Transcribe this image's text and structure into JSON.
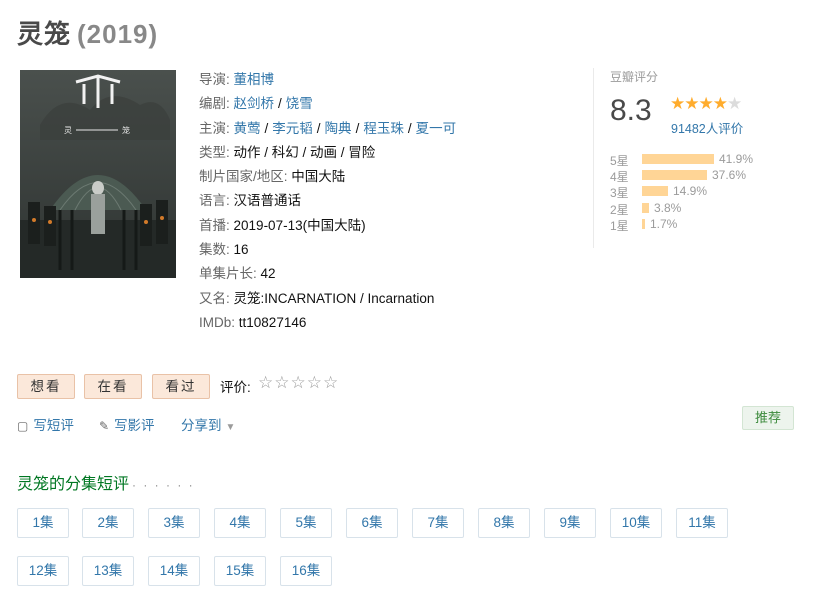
{
  "title": {
    "name": "灵笼",
    "year": "(2019)"
  },
  "poster": {
    "left_char": "灵",
    "right_char": "笼",
    "alt": "灵笼 poster"
  },
  "info": {
    "director": {
      "label": "导演:",
      "names": [
        "董相博"
      ]
    },
    "writer": {
      "label": "编剧:",
      "names": [
        "赵剑桥",
        "饶雪"
      ]
    },
    "cast": {
      "label": "主演:",
      "names": [
        "黄莺",
        "李元韬",
        "陶典",
        "程玉珠",
        "夏一可"
      ]
    },
    "genre": {
      "label": "类型:",
      "value": "动作 / 科幻 / 动画 / 冒险"
    },
    "region": {
      "label": "制片国家/地区:",
      "value": "中国大陆"
    },
    "language": {
      "label": "语言:",
      "value": "汉语普通话"
    },
    "premiere": {
      "label": "首播:",
      "value": "2019-07-13(中国大陆)"
    },
    "episodes": {
      "label": "集数:",
      "value": "16"
    },
    "runtime": {
      "label": "单集片长:",
      "value": "42"
    },
    "aka": {
      "label": "又名:",
      "value": "灵笼:INCARNATION / Incarnation"
    },
    "imdb": {
      "label": "IMDb:",
      "value": "tt10827146"
    }
  },
  "rating": {
    "label": "豆瓣评分",
    "score": "8.3",
    "stars_filled": 4,
    "stars_total": 5,
    "people": "91482人评价",
    "breakdown": [
      {
        "label": "5星",
        "pct": "41.9%",
        "value": 41.9
      },
      {
        "label": "4星",
        "pct": "37.6%",
        "value": 37.6
      },
      {
        "label": "3星",
        "pct": "14.9%",
        "value": 14.9
      },
      {
        "label": "2星",
        "pct": "3.8%",
        "value": 3.8
      },
      {
        "label": "1星",
        "pct": "1.7%",
        "value": 1.7
      }
    ]
  },
  "buttons": {
    "want": "想看",
    "watching": "在看",
    "watched": "看过"
  },
  "user_rating": {
    "label": "评价:",
    "stars": "☆☆☆☆☆"
  },
  "actions": {
    "short_review": "写短评",
    "review": "写影评",
    "share": "分享到",
    "recommend": "推荐"
  },
  "episode_section": {
    "title": "灵笼的分集短评",
    "dots": "· · · · · ·",
    "episodes": [
      "1集",
      "2集",
      "3集",
      "4集",
      "5集",
      "6集",
      "7集",
      "8集",
      "9集",
      "10集",
      "11集",
      "12集",
      "13集",
      "14集",
      "15集",
      "16集"
    ]
  },
  "colors": {
    "link": "#3377aa",
    "star": "#ffac2d",
    "bar": "#ffd596",
    "button_bg": "#fbe8da",
    "section_title": "#007722"
  }
}
